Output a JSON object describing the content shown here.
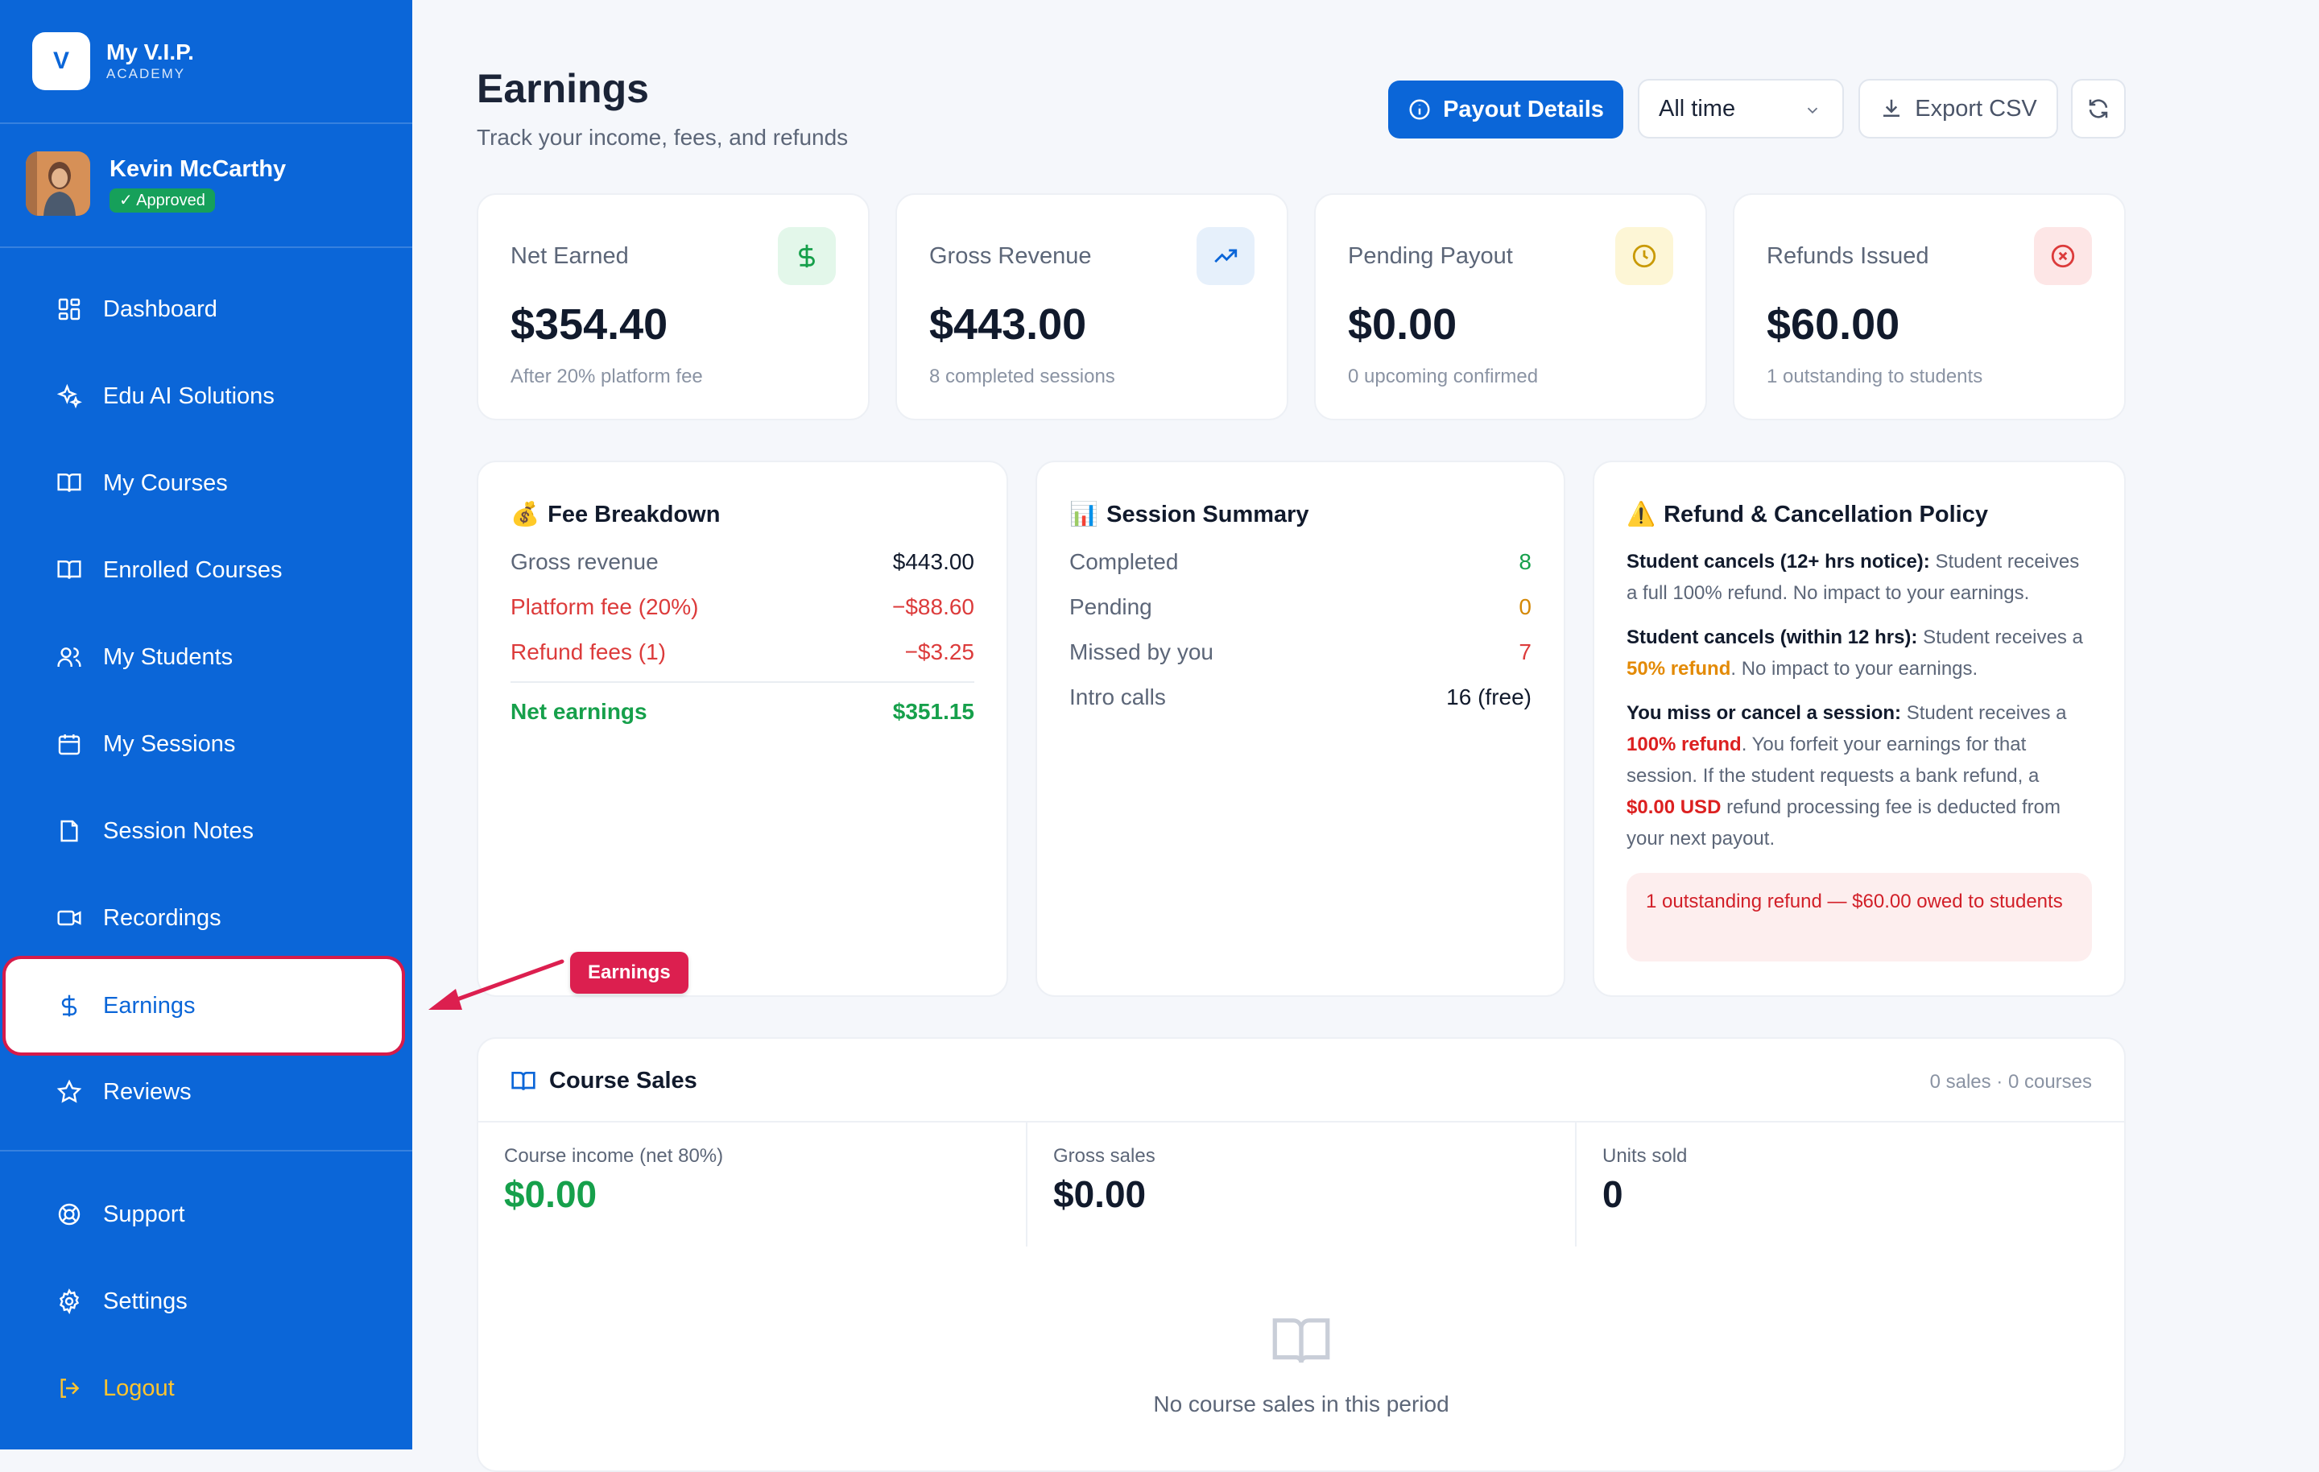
{
  "brand": {
    "letter": "V",
    "name": "My V.I.P.",
    "sub": "ACADEMY"
  },
  "profile": {
    "name": "Kevin McCarthy",
    "status": "✓ Approved"
  },
  "sidebar": {
    "items": [
      {
        "label": "Dashboard",
        "icon": "dashboard-icon"
      },
      {
        "label": "Edu AI Solutions",
        "icon": "sparkle-icon"
      },
      {
        "label": "My Courses",
        "icon": "book-open-icon"
      },
      {
        "label": "Enrolled Courses",
        "icon": "book-open-icon"
      },
      {
        "label": "My Students",
        "icon": "users-icon"
      },
      {
        "label": "My Sessions",
        "icon": "calendar-icon"
      },
      {
        "label": "Session Notes",
        "icon": "note-icon"
      },
      {
        "label": "Recordings",
        "icon": "video-icon"
      },
      {
        "label": "Earnings",
        "icon": "dollar-icon",
        "active": true
      },
      {
        "label": "Reviews",
        "icon": "star-icon"
      }
    ],
    "footer": [
      {
        "label": "Support",
        "icon": "lifebuoy-icon"
      },
      {
        "label": "Settings",
        "icon": "gear-icon"
      },
      {
        "label": "Logout",
        "icon": "logout-icon"
      }
    ]
  },
  "header": {
    "title": "Earnings",
    "subtitle": "Track your income, fees, and refunds",
    "payout_label": "Payout Details",
    "period": "All time",
    "export_label": "Export CSV"
  },
  "stats": [
    {
      "label": "Net Earned",
      "value": "$354.40",
      "note": "After 20% platform fee",
      "icon": "dollar-icon",
      "color": "#16a04b",
      "bg": "#e3f7ea"
    },
    {
      "label": "Gross Revenue",
      "value": "$443.00",
      "note": "8 completed sessions",
      "icon": "trending-up-icon",
      "color": "#0b66d8",
      "bg": "#e6f0fb"
    },
    {
      "label": "Pending Payout",
      "value": "$0.00",
      "note": "0 upcoming confirmed",
      "icon": "clock-icon",
      "color": "#c99a06",
      "bg": "#fdf6d6"
    },
    {
      "label": "Refunds Issued",
      "value": "$60.00",
      "note": "1 outstanding to students",
      "icon": "x-circle-icon",
      "color": "#dc3b3b",
      "bg": "#fde6e6"
    }
  ],
  "fee_breakdown": {
    "emoji": "💰",
    "title": "Fee Breakdown",
    "rows": [
      {
        "label": "Gross revenue",
        "value": "$443.00"
      },
      {
        "label": "Platform fee (20%)",
        "value": "−$88.60"
      },
      {
        "label": "Refund fees (1)",
        "value": "−$3.25"
      }
    ],
    "net": {
      "label": "Net earnings",
      "value": "$351.15"
    }
  },
  "session_summary": {
    "emoji": "📊",
    "title": "Session Summary",
    "rows": [
      {
        "label": "Completed",
        "value": "8",
        "color": "#16a04b"
      },
      {
        "label": "Pending",
        "value": "0",
        "color": "#d48806"
      },
      {
        "label": "Missed by you",
        "value": "7",
        "color": "#dc3b3b"
      },
      {
        "label": "Intro calls",
        "value": "16 (free)",
        "color": "#111a2c"
      }
    ]
  },
  "policy": {
    "emoji": "⚠️",
    "title": "Refund & Cancellation Policy",
    "p1_bold": "Student cancels (12+ hrs notice):",
    "p1_text": " Student receives a full 100% refund. No impact to your earnings.",
    "p2_bold": "Student cancels (within 12 hrs):",
    "p2_text": " Student receives a ",
    "p2_highlight": "50% refund",
    "p2_tail": ". No impact to your earnings.",
    "p3_bold": "You miss or cancel a session:",
    "p3_text": " Student receives a ",
    "p3_highlight": "100% refund",
    "p3_mid": ". You forfeit your earnings for that session. If the student requests a bank refund, a ",
    "p3_fee": "$0.00 USD",
    "p3_tail": " refund processing fee is deducted from your next payout.",
    "warning": "1 outstanding refund — $60.00 owed to students"
  },
  "course_sales": {
    "title": "Course Sales",
    "count": "0 sales · 0 courses",
    "cols": [
      {
        "label": "Course income (net 80%)",
        "value": "$0.00"
      },
      {
        "label": "Gross sales",
        "value": "$0.00"
      },
      {
        "label": "Units sold",
        "value": "0"
      }
    ],
    "empty": "No course sales in this period"
  },
  "annotation": {
    "label": "Earnings"
  },
  "colors": {
    "sidebar": "#0b66d8",
    "accent": "#0b66d8",
    "highlight": "#d61b4a",
    "logout": "#ffc42e"
  }
}
